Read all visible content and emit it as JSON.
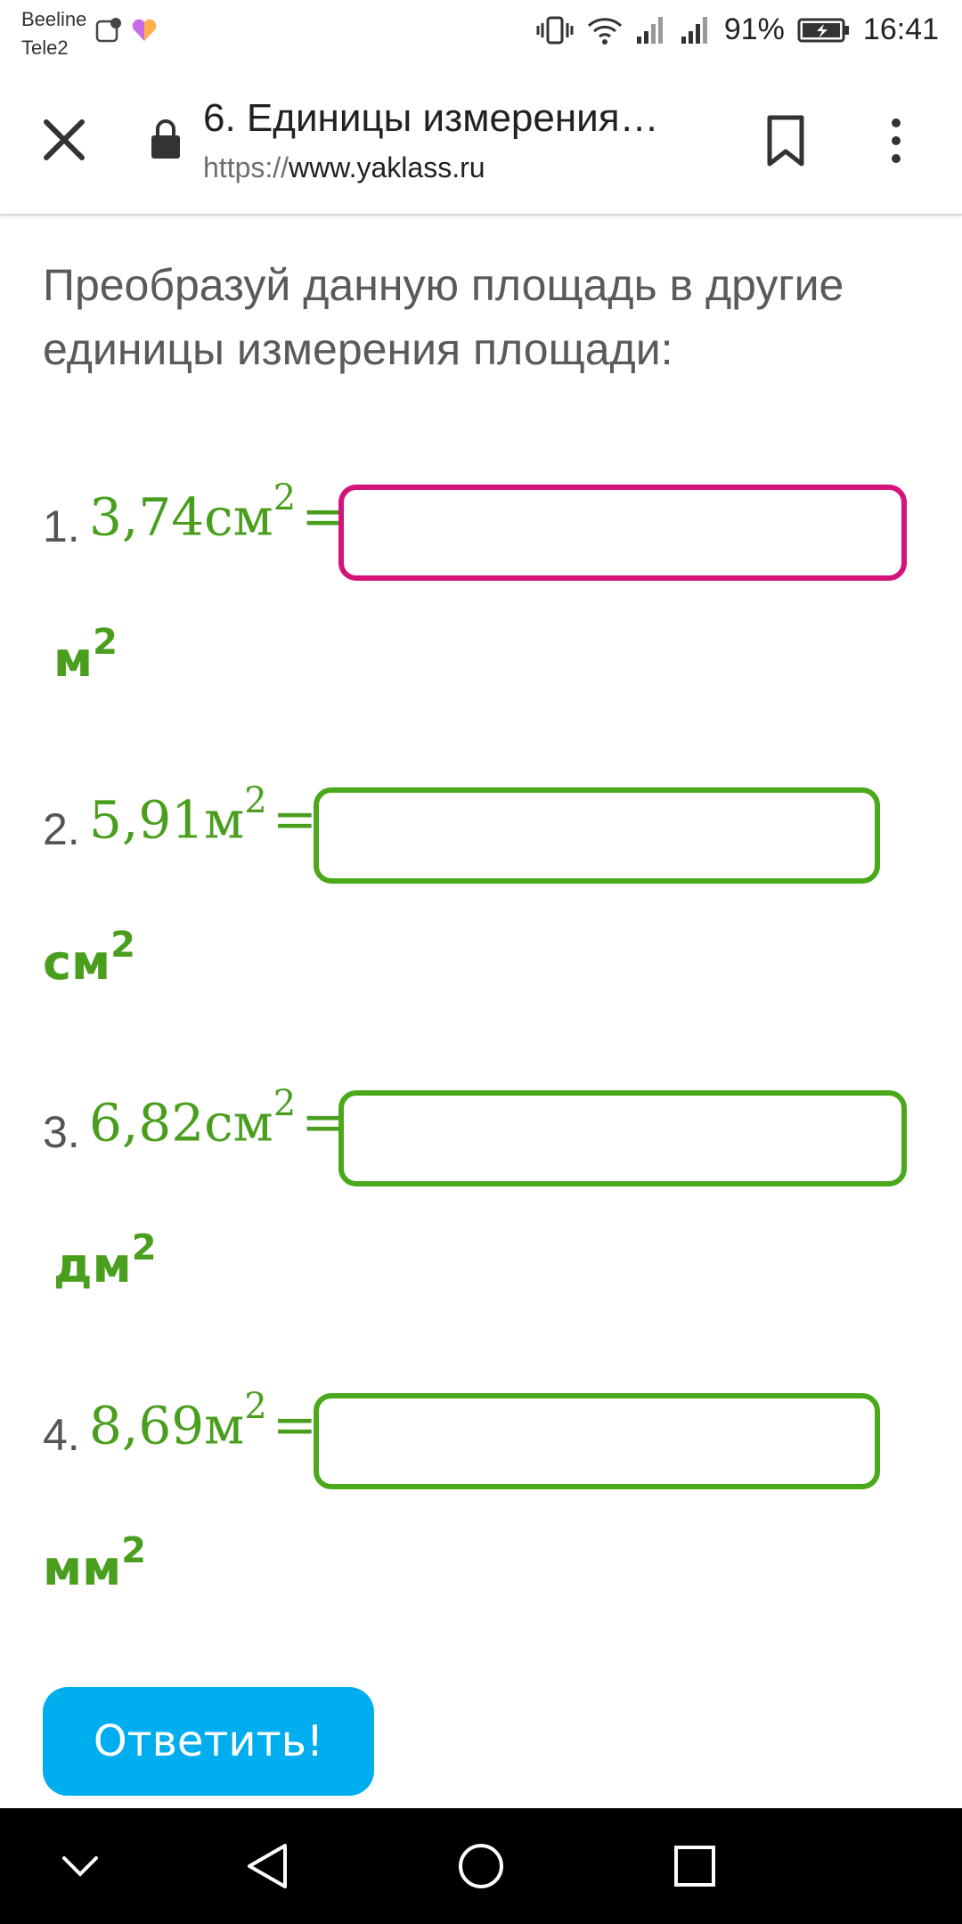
{
  "status": {
    "carrier1": "Beeline",
    "carrier2": "Tele2",
    "battery": "91%",
    "time": "16:41"
  },
  "browser": {
    "title": "6. Единицы измерения…",
    "url_scheme": "https://",
    "url_host": "www.yaklass.ru"
  },
  "task": {
    "instruction": "Преобразуй данную площадь в другие единицы измерения площади:",
    "items": [
      {
        "num": "1.",
        "value": "3,74",
        "from": "см",
        "exp": "2",
        "eq": "=",
        "input": "",
        "to": "м",
        "to_exp": "2"
      },
      {
        "num": "2.",
        "value": "5,91",
        "from": "м",
        "exp": "2",
        "eq": "=",
        "input": "",
        "to": "см",
        "to_exp": "2"
      },
      {
        "num": "3.",
        "value": "6,82",
        "from": "см",
        "exp": "2",
        "eq": "=",
        "input": "",
        "to": "дм",
        "to_exp": "2"
      },
      {
        "num": "4.",
        "value": "8,69",
        "from": "м",
        "exp": "2",
        "eq": "=",
        "input": "",
        "to": "мм",
        "to_exp": "2"
      }
    ],
    "submit_label": "Ответить!"
  },
  "colors": {
    "accent_green": "#4aa91a",
    "active_border": "#d4147a",
    "submit_blue": "#00aeef"
  }
}
